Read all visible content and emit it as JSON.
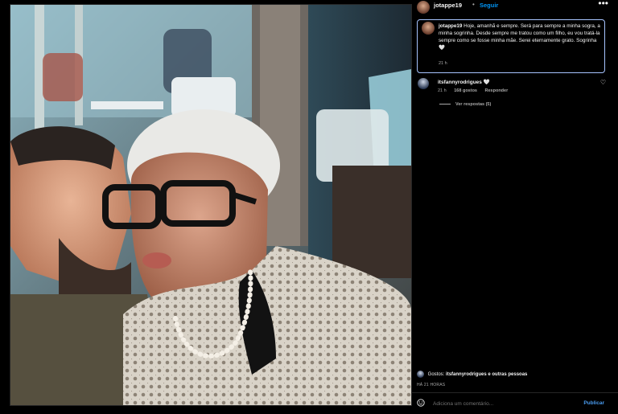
{
  "post": {
    "username": "jotappe19",
    "separator": "•",
    "follow_label": "Seguir",
    "more_label": "•••"
  },
  "caption": {
    "username": "jotappe19",
    "text": "Hoje, amanhã e sempre. Será para sempre a minha sogra, a minha sogrinha. Desde sempre me tratou como um filho, eu vou tratá-la sempre como se fosse minha mãe. Serei eternamente grato. Sogrinha 🤍",
    "time": "21 h"
  },
  "comment": {
    "username": "itsfannyrodrigues",
    "text": "🤍",
    "time": "21 h",
    "likes": "168 gostos",
    "reply_label": "Responder",
    "view_replies": "Ver respostas (5)"
  },
  "likes": {
    "label": "Gostos:",
    "summary": "itsfannyrodrigues e outras pessoas"
  },
  "post_time": "HÁ 21 HORAS",
  "composer": {
    "placeholder": "Adiciona um comentário...",
    "publish_label": "Publicar"
  },
  "icons": {
    "more": "more-horizontal-icon",
    "like": "heart-outline-icon",
    "emoji": "emoji-smile-icon"
  },
  "colors": {
    "link": "#0095f6",
    "publish": "#4a9cf0",
    "highlight_border": "#a7c4ff",
    "secondary_text": "#a8a8a8"
  }
}
